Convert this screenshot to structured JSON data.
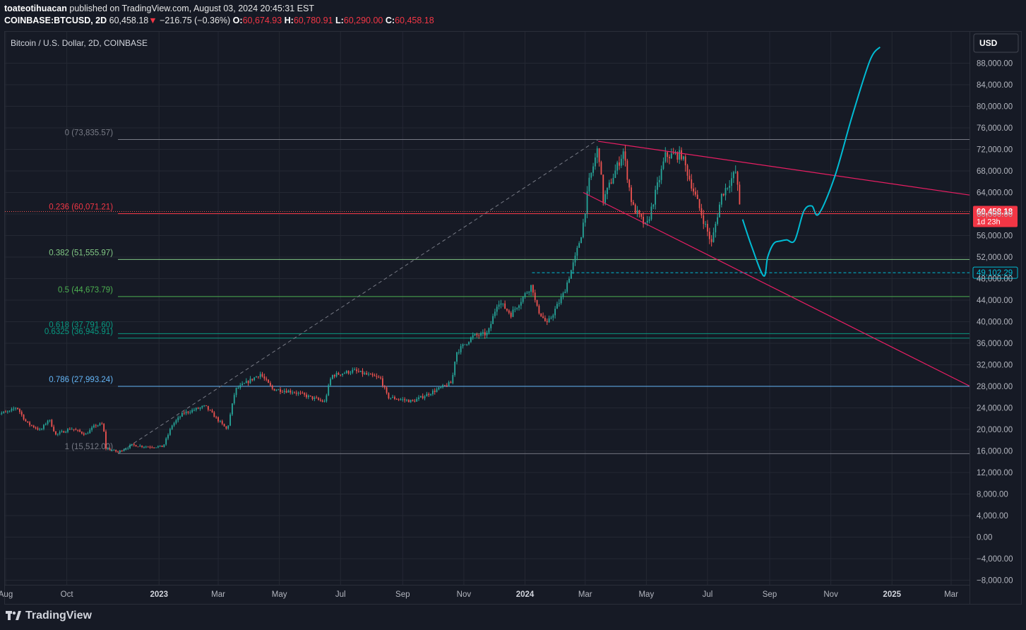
{
  "header": {
    "author": "toateotihuacan",
    "published_text": "published on TradingView.com, August 03, 2024 20:45:31 EST",
    "symbol": "COINBASE:BTCUSD, 2D",
    "last": "60,458.18",
    "arrow": "▼",
    "change": "−216.75 (−0.36%)",
    "o_label": "O:",
    "o": "60,674.93",
    "h_label": "H:",
    "h": "60,780.91",
    "l_label": "L:",
    "l": "60,290.00",
    "c_label": "C:",
    "c": "60,458.18"
  },
  "chart_title": "Bitcoin / U.S. Dollar, 2D, COINBASE",
  "currency_button": "USD",
  "footer": {
    "brand": "TradingView"
  },
  "colors": {
    "background": "#161a25",
    "grid": "#242833",
    "up": "#26a69a",
    "down": "#ef5350",
    "fib_0": "#787b86",
    "fib_236": "#f23645",
    "fib_382": "#81c784",
    "fib_5": "#4caf50",
    "fib_618": "#089981",
    "fib_786": "#64b5f6",
    "fib_1": "#787b86",
    "trendline": "#e91e63",
    "projection": "#00bcd4"
  },
  "chart_data": {
    "type": "line",
    "title": "Bitcoin / U.S. Dollar, 2D, COINBASE",
    "xlabel": "",
    "ylabel": "",
    "ylim": [
      -8000,
      92000
    ],
    "y_ticks": [
      88000,
      84000,
      80000,
      76000,
      72000,
      68000,
      64000,
      60000,
      56000,
      52000,
      48000,
      44000,
      40000,
      36000,
      32000,
      28000,
      24000,
      20000,
      16000,
      12000,
      8000,
      4000,
      0,
      -4000,
      -8000
    ],
    "y_tick_labels": [
      "88,000.00",
      "84,000.00",
      "80,000.00",
      "76,000.00",
      "72,000.00",
      "68,000.00",
      "64,000.00",
      "60,000.00",
      "56,000.00",
      "52,000.00",
      "48,000.00",
      "44,000.00",
      "40,000.00",
      "36,000.00",
      "32,000.00",
      "28,000.00",
      "24,000.00",
      "20,000.00",
      "16,000.00",
      "12,000.00",
      "8,000.00",
      "4,000.00",
      "0.00",
      "−4,000.00",
      "−8,000.00"
    ],
    "x_ticks": [
      {
        "label": "Aug",
        "date": "2022-08-01"
      },
      {
        "label": "Oct",
        "date": "2022-10-01"
      },
      {
        "label": "2023",
        "date": "2023-01-01"
      },
      {
        "label": "Mar",
        "date": "2023-03-01"
      },
      {
        "label": "May",
        "date": "2023-05-01"
      },
      {
        "label": "Jul",
        "date": "2023-07-01"
      },
      {
        "label": "Sep",
        "date": "2023-09-01"
      },
      {
        "label": "Nov",
        "date": "2023-11-01"
      },
      {
        "label": "2024",
        "date": "2024-01-01"
      },
      {
        "label": "Mar",
        "date": "2024-03-01"
      },
      {
        "label": "May",
        "date": "2024-05-01"
      },
      {
        "label": "Jul",
        "date": "2024-07-01"
      },
      {
        "label": "Sep",
        "date": "2024-09-01"
      },
      {
        "label": "Nov",
        "date": "2024-11-01"
      },
      {
        "label": "2025",
        "date": "2025-01-01"
      },
      {
        "label": "Mar",
        "date": "2025-03-01"
      }
    ],
    "price_anchors": [
      [
        "2022-07-20",
        22800
      ],
      [
        "2022-08-05",
        23300
      ],
      [
        "2022-08-12",
        24200
      ],
      [
        "2022-08-22",
        21200
      ],
      [
        "2022-09-05",
        19800
      ],
      [
        "2022-09-13",
        22000
      ],
      [
        "2022-09-20",
        19000
      ],
      [
        "2022-10-05",
        20200
      ],
      [
        "2022-10-20",
        19100
      ],
      [
        "2022-10-29",
        20700
      ],
      [
        "2022-11-06",
        21000
      ],
      [
        "2022-11-09",
        16500
      ],
      [
        "2022-11-21",
        15800
      ],
      [
        "2022-12-05",
        17100
      ],
      [
        "2022-12-20",
        16800
      ],
      [
        "2023-01-05",
        16800
      ],
      [
        "2023-01-14",
        20800
      ],
      [
        "2023-01-25",
        23000
      ],
      [
        "2023-02-16",
        24300
      ],
      [
        "2023-03-10",
        19900
      ],
      [
        "2023-03-18",
        27400
      ],
      [
        "2023-04-12",
        30300
      ],
      [
        "2023-04-24",
        27500
      ],
      [
        "2023-05-15",
        27000
      ],
      [
        "2023-06-15",
        25100
      ],
      [
        "2023-06-22",
        30000
      ],
      [
        "2023-07-14",
        30900
      ],
      [
        "2023-08-10",
        29400
      ],
      [
        "2023-08-17",
        26000
      ],
      [
        "2023-09-11",
        25200
      ],
      [
        "2023-10-01",
        27000
      ],
      [
        "2023-10-20",
        28700
      ],
      [
        "2023-10-24",
        34200
      ],
      [
        "2023-11-10",
        37300
      ],
      [
        "2023-11-25",
        37800
      ],
      [
        "2023-12-05",
        43900
      ],
      [
        "2023-12-18",
        41400
      ],
      [
        "2024-01-08",
        46900
      ],
      [
        "2024-01-12",
        42800
      ],
      [
        "2024-01-23",
        39500
      ],
      [
        "2024-02-08",
        45000
      ],
      [
        "2024-02-20",
        51800
      ],
      [
        "2024-02-27",
        57000
      ],
      [
        "2024-03-05",
        66000
      ],
      [
        "2024-03-14",
        72500
      ],
      [
        "2024-03-19",
        62500
      ],
      [
        "2024-04-08",
        71600
      ],
      [
        "2024-04-17",
        61500
      ],
      [
        "2024-05-01",
        57500
      ],
      [
        "2024-05-20",
        70800
      ],
      [
        "2024-06-05",
        71000
      ],
      [
        "2024-06-24",
        60500
      ],
      [
        "2024-07-05",
        54500
      ],
      [
        "2024-07-15",
        63500
      ],
      [
        "2024-07-29",
        67800
      ],
      [
        "2024-08-03",
        60458
      ]
    ],
    "series": [
      {
        "name": "Projection",
        "values": [
          [
            "2024-08-05",
            59000
          ],
          [
            "2024-08-14",
            54000
          ],
          [
            "2024-08-26",
            48500
          ],
          [
            "2024-08-30",
            52000
          ],
          [
            "2024-09-05",
            54500
          ],
          [
            "2024-09-12",
            55000
          ],
          [
            "2024-09-18",
            55200
          ],
          [
            "2024-09-26",
            55100
          ],
          [
            "2024-10-05",
            60500
          ],
          [
            "2024-10-13",
            61500
          ],
          [
            "2024-10-20",
            60000
          ],
          [
            "2024-11-05",
            67000
          ],
          [
            "2024-11-22",
            78000
          ],
          [
            "2024-12-10",
            88500
          ],
          [
            "2024-12-20",
            91000
          ]
        ]
      }
    ],
    "fibonacci": [
      {
        "level": "0",
        "price": 73835.57,
        "label": "0 (73,835.57)"
      },
      {
        "level": "0.236",
        "price": 60071.21,
        "label": "0.236 (60,071.21)"
      },
      {
        "level": "0.382",
        "price": 51555.97,
        "label": "0.382 (51,555.97)"
      },
      {
        "level": "0.5",
        "price": 44673.79,
        "label": "0.5 (44,673.79)"
      },
      {
        "level": "0.618",
        "price": 37791.6,
        "label": "0.618 (37,791.60)"
      },
      {
        "level": "0.6325",
        "price": 36945.91,
        "label": "0.6325 (36,945.91)"
      },
      {
        "level": "0.786",
        "price": 27993.24,
        "label": "0.786 (27,993.24)"
      },
      {
        "level": "1",
        "price": 15512.0,
        "label": "1 (15,512.00)"
      }
    ],
    "fib_anchor_start": [
      "2022-11-21",
      15512
    ],
    "fib_anchor_end": [
      "2024-03-14",
      73835.57
    ],
    "trendlines": [
      {
        "from": [
          "2024-03-14",
          73500
        ],
        "to": [
          "2025-03-20",
          63500
        ]
      },
      {
        "from": [
          "2024-02-28",
          64000
        ],
        "to": [
          "2025-03-20",
          28000
        ]
      }
    ],
    "horizontal_ray": {
      "price": 49102.29,
      "from": "2024-01-08",
      "label": "49,102.29"
    },
    "last_price": {
      "price": 60458.18,
      "label": "60,458.18",
      "countdown": "1d 23h"
    }
  }
}
